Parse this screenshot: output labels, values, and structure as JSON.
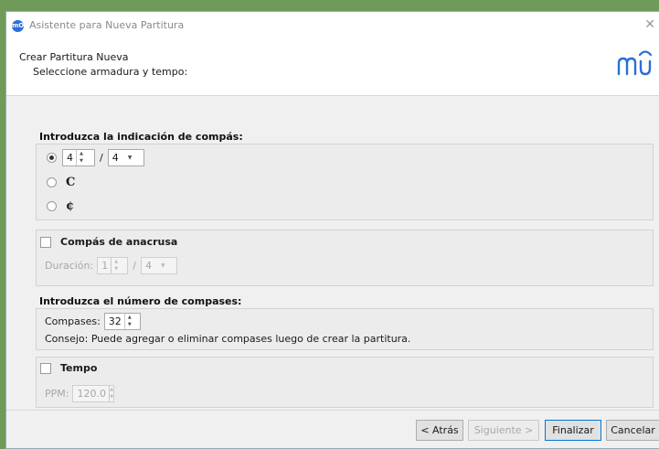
{
  "window": {
    "title": "Asistente para Nueva Partitura",
    "app_icon_text": "mO"
  },
  "header": {
    "title": "Crear Partitura Nueva",
    "subtitle": "Seleccione armadura y tempo:"
  },
  "time_signature": {
    "title": "Introduzca la indicación de compás:",
    "numerator": "4",
    "denominator": "4",
    "separator": "/",
    "selected": "numeric",
    "common_glyph": "C",
    "cut_glyph": "¢"
  },
  "pickup": {
    "label": "Compás de anacrusa",
    "checked": false,
    "duration_label": "Duración:",
    "numerator": "1",
    "denominator": "4",
    "separator": "/"
  },
  "measures": {
    "title": "Introduzca el número de compases:",
    "label": "Compases:",
    "value": "32",
    "hint": "Consejo: Puede agregar o eliminar compases luego de crear la partitura."
  },
  "tempo": {
    "label": "Tempo",
    "checked": false,
    "bpm_label": "PPM:",
    "bpm_value": "120.0"
  },
  "footer": {
    "back_label": "< Atrás",
    "next_label": "Siguiente >",
    "finish_label": "Finalizar",
    "cancel_label": "Cancelar"
  },
  "colors": {
    "accent": "#0078d7",
    "logo": "#2a6fd6"
  }
}
